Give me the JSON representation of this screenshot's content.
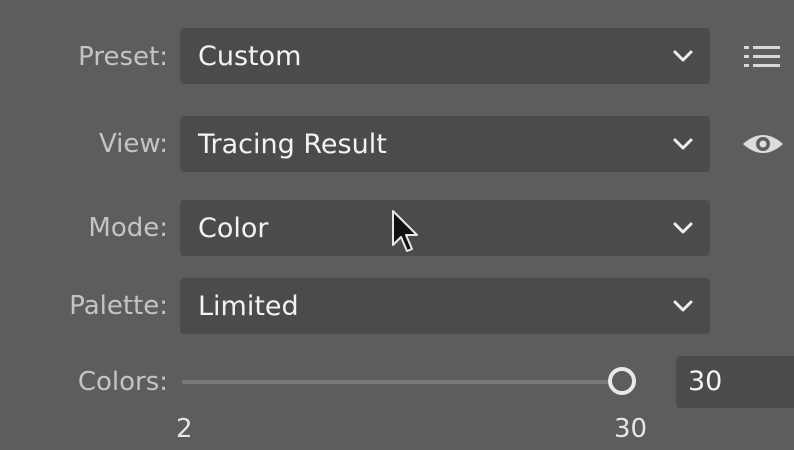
{
  "preset": {
    "label": "Preset:",
    "value": "Custom",
    "menu_icon": "list-menu-icon"
  },
  "view": {
    "label": "View:",
    "value": "Tracing Result",
    "eye_icon": "eye-icon"
  },
  "mode": {
    "label": "Mode:",
    "value": "Color"
  },
  "palette": {
    "label": "Palette:",
    "value": "Limited"
  },
  "colors": {
    "label": "Colors:",
    "value": "30",
    "min_label": "2",
    "max_label": "30",
    "min": 2,
    "max": 30,
    "current": 30
  },
  "theme": {
    "background": "#5d5d5d",
    "field": "#4b4b4b",
    "text": "#f3f3f3",
    "label": "#c4c4c4"
  }
}
